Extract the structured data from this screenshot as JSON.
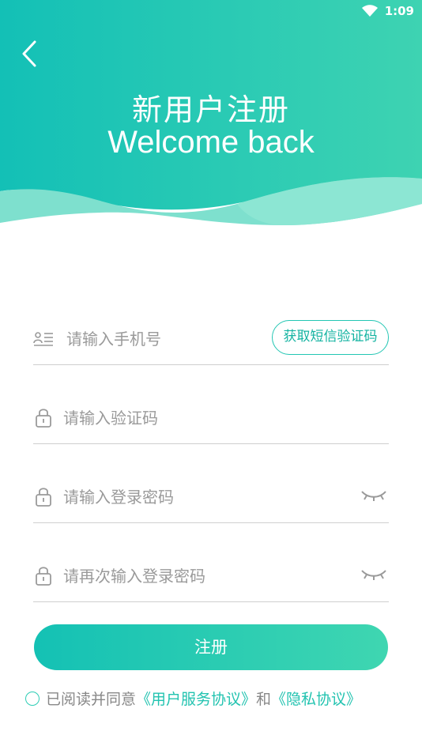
{
  "status_bar": {
    "time": "1:09"
  },
  "header": {
    "title_cn": "新用户注册",
    "title_en": "Welcome back"
  },
  "form": {
    "phone_placeholder": "请输入手机号",
    "get_code_label": "获取短信验证码",
    "code_placeholder": "请输入验证码",
    "password_placeholder": "请输入登录密码",
    "confirm_placeholder": "请再次输入登录密码"
  },
  "register_label": "注册",
  "agreement": {
    "prefix": "已阅读并同意",
    "user_agreement": "《用户服务协议》",
    "and": "和",
    "privacy": "《隐私协议》"
  },
  "colors": {
    "accent": "#1fc6b4",
    "accent_light": "#8ee6d2",
    "text_muted": "#9a9a9a"
  }
}
